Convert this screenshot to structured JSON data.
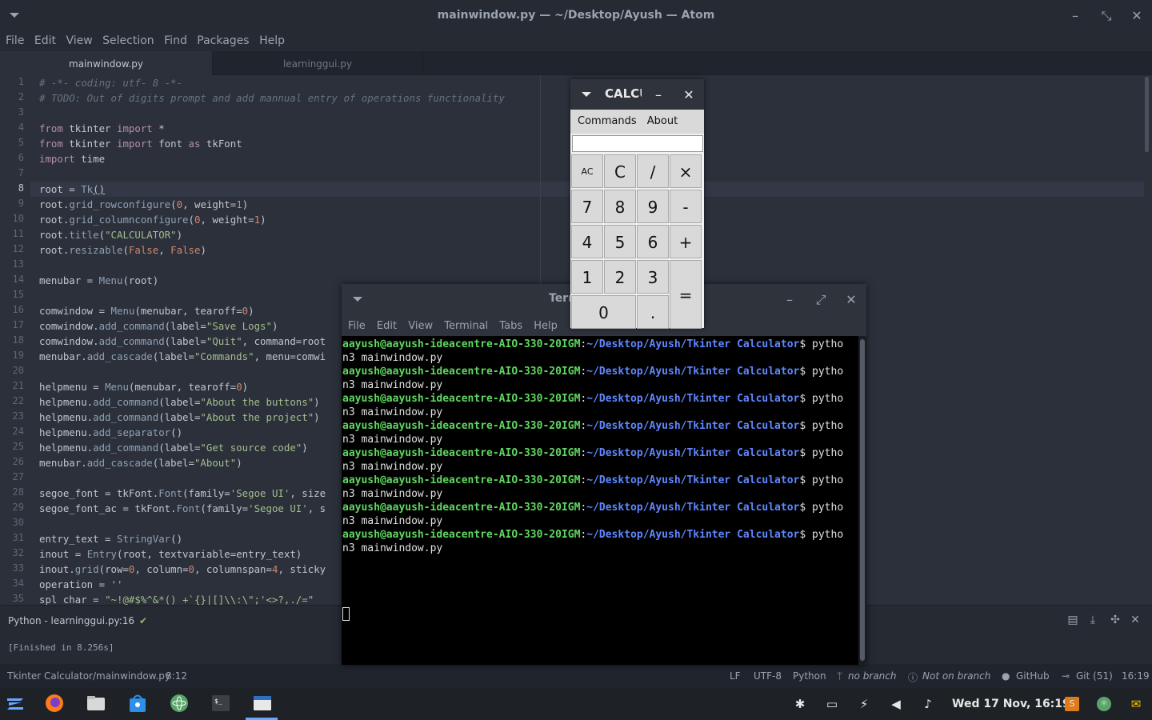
{
  "atom": {
    "window_title": "mainwindow.py — ~/Desktop/Ayush — Atom",
    "menu": [
      "File",
      "Edit",
      "View",
      "Selection",
      "Find",
      "Packages",
      "Help"
    ],
    "tabs": [
      "mainwindow.py",
      "learninggui.py"
    ],
    "line_numbers": [
      "1",
      "2",
      "3",
      "4",
      "5",
      "6",
      "7",
      "8",
      "9",
      "10",
      "11",
      "12",
      "13",
      "14",
      "15",
      "16",
      "17",
      "18",
      "19",
      "20",
      "21",
      "22",
      "23",
      "24",
      "25",
      "26",
      "27",
      "28",
      "29",
      "30",
      "31",
      "32",
      "33",
      "34",
      "35"
    ],
    "current_line": 8,
    "bottom_panel": {
      "header": "Python - learninggui.py:16",
      "output": "[Finished in 8.256s]"
    },
    "status": {
      "file": "Tkinter Calculator/mainwindow.py",
      "position": "8:12",
      "line_ending": "LF",
      "encoding": "UTF-8",
      "grammar": "Python",
      "branch": "no branch",
      "not_on_branch": "Not on branch",
      "github": "GitHub",
      "git": "Git (51)",
      "time": "16:19"
    }
  },
  "code": {
    "l1": "# -*- coding: utf- 8 -*-",
    "l2": "# TODO: Out of digits prompt and add mannual entry of operations functionality",
    "l4a": "from",
    "l4b": " tkinter ",
    "l4c": "import",
    "l4d": " *",
    "l5a": "from",
    "l5b": " tkinter ",
    "l5c": "import",
    "l5d": " font ",
    "l5e": "as",
    "l5f": " tkFont",
    "l6a": "import",
    "l6b": " time",
    "l8a": "root = ",
    "l8b": "Tk",
    "l8c": "()",
    "l9a": "root.",
    "l9b": "grid_rowconfigure",
    "l9c": "(",
    "l9d": "0",
    "l9e": ", weight=",
    "l9f": "1",
    "l9g": ")",
    "l10a": "root.",
    "l10b": "grid_columnconfigure",
    "l10c": "(",
    "l10d": "0",
    "l10e": ", weight=",
    "l10f": "1",
    "l10g": ")",
    "l11a": "root.",
    "l11b": "title",
    "l11c": "(",
    "l11d": "\"CALCULATOR\"",
    "l11e": ")",
    "l12a": "root.",
    "l12b": "resizable",
    "l12c": "(",
    "l12d": "False",
    "l12e": ", ",
    "l12f": "False",
    "l12g": ")",
    "l14a": "menubar = ",
    "l14b": "Menu",
    "l14c": "(root)",
    "l16a": "comwindow = ",
    "l16b": "Menu",
    "l16c": "(menubar, tearoff=",
    "l16d": "0",
    "l16e": ")",
    "l17a": "comwindow.",
    "l17b": "add_command",
    "l17c": "(label=",
    "l17d": "\"Save Logs\"",
    "l17e": ")",
    "l18a": "comwindow.",
    "l18b": "add_command",
    "l18c": "(label=",
    "l18d": "\"Quit\"",
    "l18e": ", command=root",
    "l19a": "menubar.",
    "l19b": "add_cascade",
    "l19c": "(label=",
    "l19d": "\"Commands\"",
    "l19e": ", menu=comwi",
    "l21a": "helpmenu = ",
    "l21b": "Menu",
    "l21c": "(menubar, tearoff=",
    "l21d": "0",
    "l21e": ")",
    "l22a": "helpmenu.",
    "l22b": "add_command",
    "l22c": "(label=",
    "l22d": "\"About the buttons\"",
    "l22e": ")",
    "l23a": "helpmenu.",
    "l23b": "add_command",
    "l23c": "(label=",
    "l23d": "\"About the project\"",
    "l23e": ")",
    "l24a": "helpmenu.",
    "l24b": "add_separator",
    "l24c": "()",
    "l25a": "helpmenu.",
    "l25b": "add_command",
    "l25c": "(label=",
    "l25d": "\"Get source code\"",
    "l25e": ")",
    "l26a": "menubar.",
    "l26b": "add_cascade",
    "l26c": "(label=",
    "l26d": "\"About\"",
    "l26e": ")",
    "l28a": "segoe_font = tkFont.",
    "l28b": "Font",
    "l28c": "(family=",
    "l28d": "'Segoe UI'",
    "l28e": ", size",
    "l29a": "segoe_font_ac = tkFont.",
    "l29b": "Font",
    "l29c": "(family=",
    "l29d": "'Segoe UI'",
    "l29e": ", s",
    "l31a": "entry_text = ",
    "l31b": "StringVar",
    "l31c": "()",
    "l32a": "inout = ",
    "l32b": "Entry",
    "l32c": "(root, textvariable=entry_text)",
    "l33a": "inout.",
    "l33b": "grid",
    "l33c": "(row=",
    "l33d": "0",
    "l33e": ", column=",
    "l33f": "0",
    "l33g": ", columnspan=",
    "l33h": "4",
    "l33i": ", sticky",
    "l34a": "operation = ",
    "l34b": "''",
    "l35a": "spl_char = ",
    "l35b": "\"~!@#$%^&*() +`{}|[]\\\\:\\\";'<>?,./=\""
  },
  "terminal": {
    "title": "Terminal",
    "menu": [
      "File",
      "Edit",
      "View",
      "Terminal",
      "Tabs",
      "Help"
    ],
    "user": "aayush@aayush-ideacentre-AIO-330-20IGM",
    "path": "~/Desktop/Ayush/Tkinter Calculator",
    "prompt_tail": "$ pytho",
    "wrap": "n3 mainwindow.py"
  },
  "calculator": {
    "title": "CALCULATOR",
    "menu": [
      "Commands",
      "About"
    ],
    "entry_value": "",
    "buttons": {
      "ac": "AC",
      "c": "C",
      "div": "/",
      "mul": "×",
      "seven": "7",
      "eight": "8",
      "nine": "9",
      "minus": "-",
      "four": "4",
      "five": "5",
      "six": "6",
      "plus": "+",
      "one": "1",
      "two": "2",
      "three": "3",
      "equals": "=",
      "zero": "0",
      "dot": "."
    }
  },
  "taskbar": {
    "clock": "Wed 17 Nov, 16:19",
    "apps": [
      "zorin-menu-icon",
      "firefox-icon",
      "files-icon",
      "software-store-icon",
      "atom-icon",
      "terminal-icon",
      "calculator-window-icon"
    ],
    "tray": [
      "bluetooth-icon",
      "screen-icon",
      "power-icon",
      "volume-icon",
      "notification-bell-icon",
      "sublime-icon",
      "atom-tray-icon",
      "mail-icon"
    ]
  },
  "colors": {
    "editor_bg": "#2b303b",
    "terminal_user": "#5fd75f",
    "terminal_path": "#5f87ff",
    "check": "#8fbf6a"
  }
}
